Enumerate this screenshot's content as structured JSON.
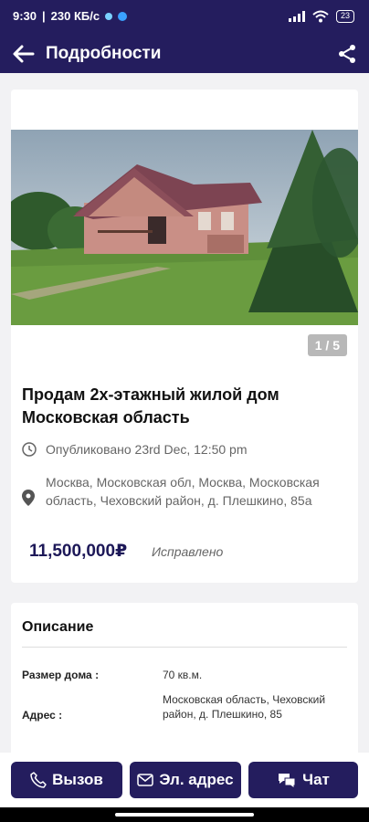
{
  "status_bar": {
    "time": "9:30",
    "speed": "230 КБ/с",
    "battery": "23"
  },
  "app_bar": {
    "title": "Подробности"
  },
  "listing": {
    "image_counter": "1 / 5",
    "title": "Продам 2х-этажный жилой дом Московская область",
    "published": "Опубликовано 23rd Dec, 12:50 pm",
    "address": "Москва, Московская обл, Москва, Московская область, Чеховский район, д. Плешкино, 85а",
    "price": "11,500,000₽",
    "edited_label": "Исправлено"
  },
  "description": {
    "title": "Описание",
    "rows": [
      {
        "label": "Размер дома :",
        "value": "70 кв.м."
      },
      {
        "label": "Адрес :",
        "value": "Московская область, Чеховский район, д. Плешкино, 85"
      }
    ]
  },
  "actions": {
    "call": "Вызов",
    "email": "Эл. адрес",
    "chat": "Чат"
  },
  "colors": {
    "primary": "#241d5e",
    "background": "#f2f2f4"
  }
}
